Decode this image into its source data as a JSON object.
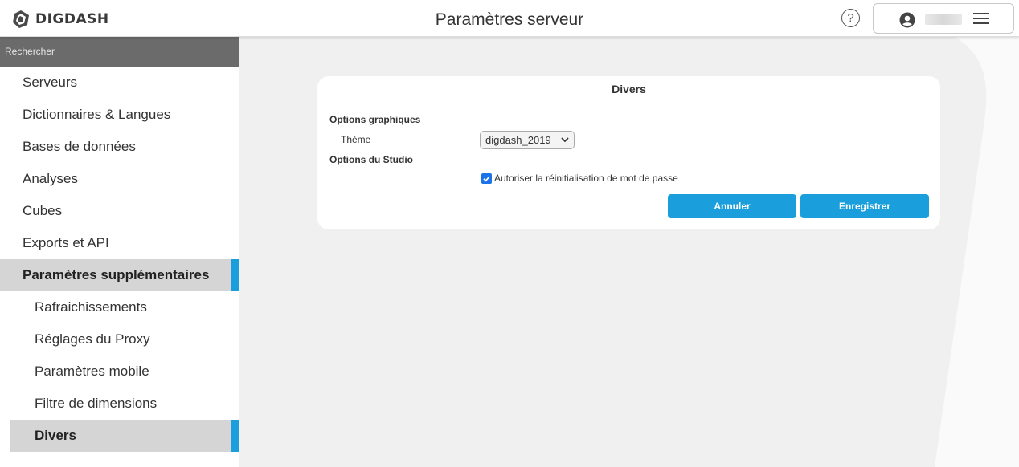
{
  "header": {
    "logo_text": "DIGDASH",
    "title": "Paramètres serveur",
    "help_icon": "help-circle-icon",
    "help_glyph": "?",
    "user_icon": "user-avatar-icon",
    "menu_icon": "hamburger-menu-icon"
  },
  "sidebar": {
    "search_placeholder": "Rechercher",
    "items": [
      {
        "label": "Serveurs"
      },
      {
        "label": "Dictionnaires & Langues"
      },
      {
        "label": "Bases de données"
      },
      {
        "label": "Analyses"
      },
      {
        "label": "Cubes"
      },
      {
        "label": "Exports et API"
      },
      {
        "label": "Paramètres supplémentaires",
        "active": true
      },
      {
        "label": "Rafraichissements"
      },
      {
        "label": "Réglages du Proxy"
      },
      {
        "label": "Paramètres mobile"
      },
      {
        "label": "Filtre de dimensions"
      },
      {
        "label": "Divers",
        "active": true
      }
    ]
  },
  "panel": {
    "title": "Divers",
    "graphics_section": "Options graphiques",
    "theme_label": "Thème",
    "theme_value": "digdash_2019",
    "studio_section": "Options du Studio",
    "reset_password_label": "Autoriser la réinitialisation de mot de passe",
    "reset_password_checked": true,
    "cancel_label": "Annuler",
    "save_label": "Enregistrer"
  },
  "colors": {
    "accent": "#1a9fdc",
    "sidebar_search_bg": "#6b6b6b",
    "active_item_bg": "#d5d5d5",
    "content_bg": "#f0f0f0"
  }
}
